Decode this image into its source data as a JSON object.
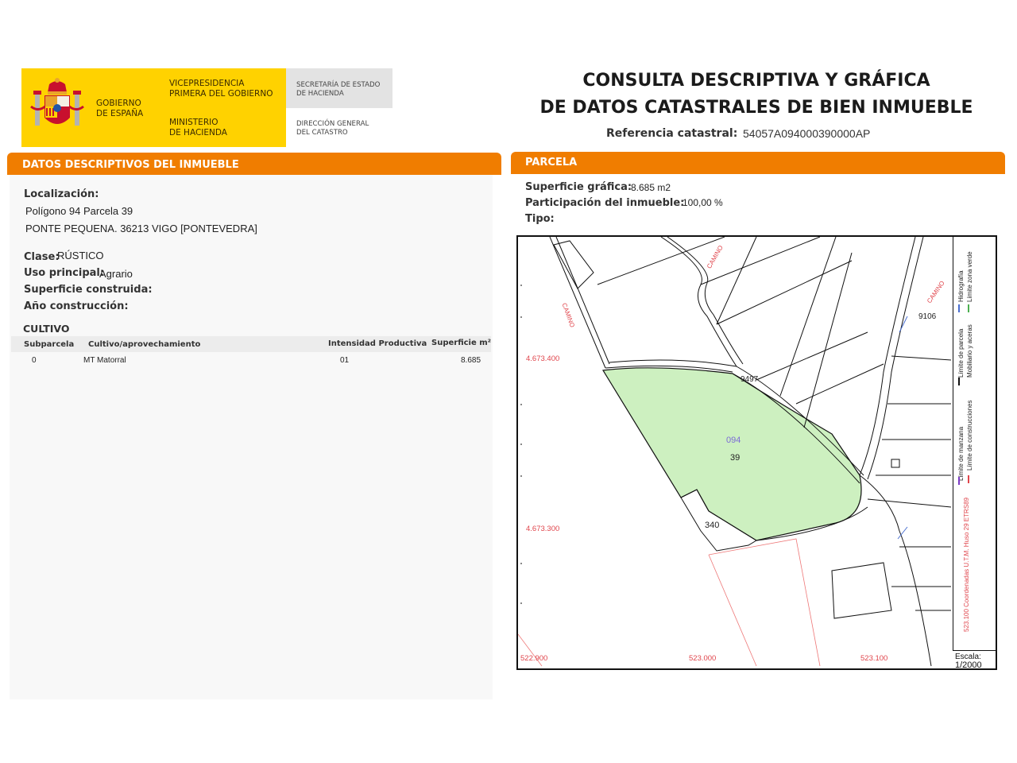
{
  "header": {
    "gov_line1": "GOBIERNO",
    "gov_line2": "DE ESPAÑA",
    "vice_line1": "VICEPRESIDENCIA",
    "vice_line2": "PRIMERA DEL GOBIERNO",
    "min_line1": "MINISTERIO",
    "min_line2": "DE HACIENDA",
    "sec_line1": "SECRETARÍA DE ESTADO",
    "sec_line2": "DE HACIENDA",
    "dg_line1": "DIRECCIÓN GENERAL",
    "dg_line2": "DEL CATASTRO",
    "title_line1": "CONSULTA DESCRIPTIVA Y GRÁFICA",
    "title_line2": "DE DATOS CATASTRALES DE BIEN INMUEBLE",
    "ref_label": "Referencia catastral:",
    "ref_value": "54057A094000390000AP"
  },
  "left_panel": {
    "bar_title": "DATOS DESCRIPTIVOS DEL INMUEBLE",
    "localizacion_label": "Localización:",
    "localizacion_line1": "Polígono 94 Parcela 39",
    "localizacion_line2": "PONTE PEQUENA. 36213 VIGO [PONTEVEDRA]",
    "clase_label": "Clase:",
    "clase_value": "RÚSTICO",
    "uso_label": "Uso principal:",
    "uso_value": "Agrario",
    "superficie_label": "Superficie construida:",
    "anio_label": "Año construcción:",
    "cultivo_heading": "CULTIVO",
    "table_headers": [
      "Subparcela",
      "Cultivo/aprovechamiento",
      "Intensidad Productiva",
      "Superficie m²"
    ],
    "table_rows": [
      [
        "0",
        "MT Matorral",
        "01",
        "8.685"
      ]
    ]
  },
  "right_panel": {
    "bar_title": "PARCELA",
    "superficie_label": "Superficie gráfica:",
    "superficie_value": "8.685 m2",
    "participacion_label": "Participación del inmueble:",
    "participacion_value": "100,00 %",
    "tipo_label": "Tipo:"
  },
  "map": {
    "parcel_color": "#cdf0c0",
    "coord_color": "#e0454c",
    "y_coord_top": "4.673.400",
    "y_coord_bottom": "4.673.300",
    "x_coord_left": "522.900",
    "x_coord_mid": "523.000",
    "x_coord_right": "523.100",
    "poligono_label": "094",
    "parcela_label": "39",
    "label_340": "340",
    "label_9106": "9106",
    "label_9497": "9497",
    "road_label_1": "CAMINO",
    "road_label_2": "CAMINO",
    "road_label_3": "CAMINO",
    "legend_1": "Límite de manzana",
    "legend_2": "Límite de parcela",
    "legend_3": "Hidrografía",
    "legend_4": "Límite de construcciones",
    "legend_5": "Mobiliario y aceras",
    "legend_6": "Límite zona verde",
    "legend_coord": "523.100 Coordenadas U.T.M. Huso 29 ETRS89",
    "escala_label": "Escala:",
    "escala_value": "1/2000"
  },
  "colors": {
    "orange": "#f07d00",
    "yellow": "#ffd200",
    "red": "#c8102e"
  }
}
